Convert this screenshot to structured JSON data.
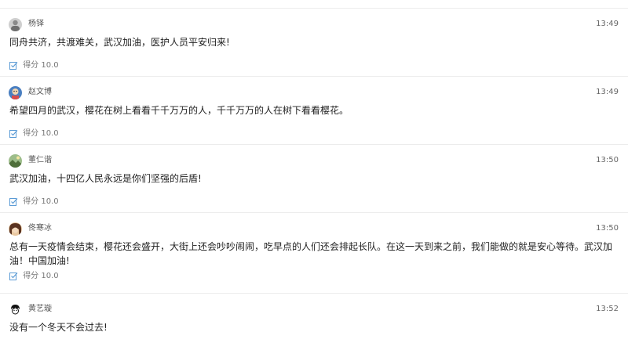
{
  "score_label": "得分",
  "comments": [
    {
      "name": "杨铎",
      "time": "13:49",
      "content": "同舟共济，共渡难关，武汉加油，医护人员平安归来!",
      "score": "10.0",
      "avatar_icon": "avatar-grey-portrait"
    },
    {
      "name": "赵文博",
      "time": "13:49",
      "content": "希望四月的武汉，樱花在树上看看千千万万的人，千千万万的人在树下看看樱花。",
      "score": "10.0",
      "avatar_icon": "avatar-blue-cartoon"
    },
    {
      "name": "董仁谐",
      "time": "13:50",
      "content": "武汉加油，十四亿人民永远是你们坚强的后盾!",
      "score": "10.0",
      "avatar_icon": "avatar-green-landscape"
    },
    {
      "name": "佟寒冰",
      "time": "13:50",
      "content": "总有一天疫情会结束，樱花还会盛开，大街上还会吵吵闹闹，吃早点的人们还会排起长队。在这一天到来之前，我们能做的就是安心等待。武汉加油！中国加油!",
      "score": "10.0",
      "avatar_icon": "avatar-brown-hair"
    },
    {
      "name": "黄艺璇",
      "time": "13:52",
      "content": "没有一个冬天不会过去!",
      "score": "",
      "avatar_icon": "avatar-bw-cartoon"
    }
  ],
  "colors": {
    "score_icon": "#5b9bd5",
    "divider": "#ececec"
  }
}
